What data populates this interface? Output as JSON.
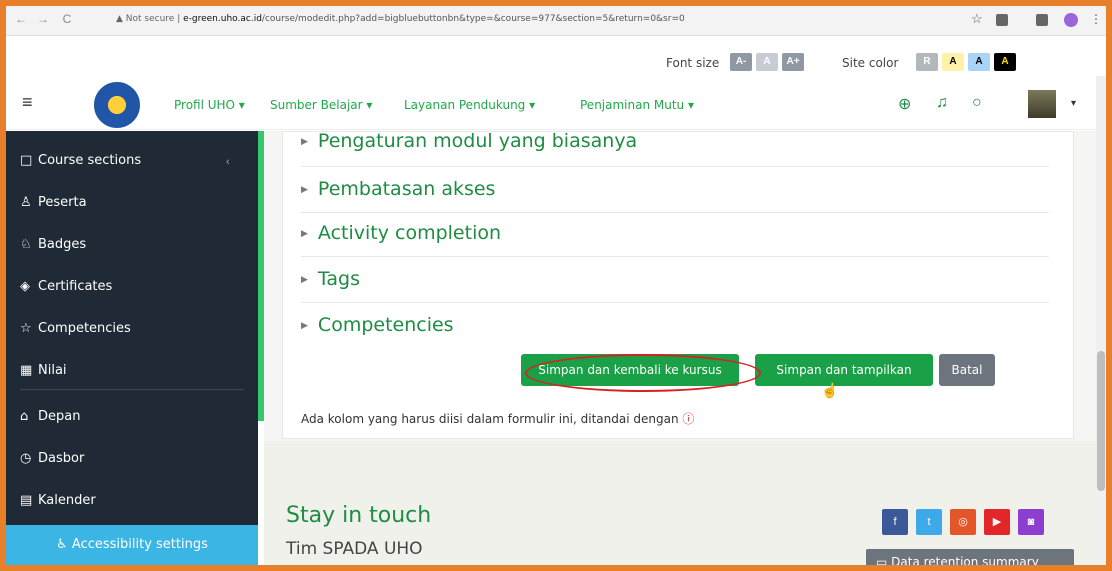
{
  "browser": {
    "back": "←",
    "forward": "→",
    "reload": "C",
    "warning": "▲ Not secure |",
    "host": "e-green.uho.ac.id",
    "path": "/course/modedit.php?add=bigbluebuttonbn&type=&course=977&section=5&return=0&sr=0"
  },
  "a11y": {
    "font_size_label": "Font size",
    "site_color_label": "Site color",
    "font_chips": [
      "A-",
      "A",
      "A+"
    ],
    "color_chips": [
      "R",
      "A",
      "A",
      "A"
    ]
  },
  "nav": {
    "menu": [
      "Profil UHO ▾",
      "Sumber Belajar ▾",
      "Layanan Pendukung ▾",
      "Penjaminan Mutu ▾"
    ]
  },
  "sidebar": {
    "items": [
      {
        "icon": "□",
        "label": "Course sections"
      },
      {
        "icon": "♙",
        "label": "Peserta"
      },
      {
        "icon": "♘",
        "label": "Badges"
      },
      {
        "icon": "◈",
        "label": "Certificates"
      },
      {
        "icon": "☆",
        "label": "Competencies"
      },
      {
        "icon": "▦",
        "label": "Nilai"
      },
      {
        "icon": "⌂",
        "label": "Depan"
      },
      {
        "icon": "◷",
        "label": "Dasbor"
      },
      {
        "icon": "▤",
        "label": "Kalender"
      }
    ],
    "accessibility_settings": "Accessibility settings"
  },
  "form": {
    "sections": [
      "Pengaturan modul yang biasanya",
      "Pembatasan akses",
      "Activity completion",
      "Tags",
      "Competencies"
    ],
    "buttons": {
      "save_return": "Simpan dan kembali ke kursus",
      "save_display": "Simpan dan tampilkan",
      "cancel": "Batal"
    },
    "required_note": "Ada kolom yang harus diisi dalam formulir ini, ditandai dengan",
    "required_icon": "ⓘ"
  },
  "footer": {
    "stay_in_touch": "Stay in touch",
    "team": "Tim SPADA UHO",
    "social": [
      "f",
      "t",
      "◎",
      "▶",
      "◙"
    ],
    "data_retention": "Data retention summary"
  },
  "colors": {
    "accent_green": "#1aa148",
    "sidebar_dark": "#1f2a36",
    "highlight_red": "#d62222"
  }
}
